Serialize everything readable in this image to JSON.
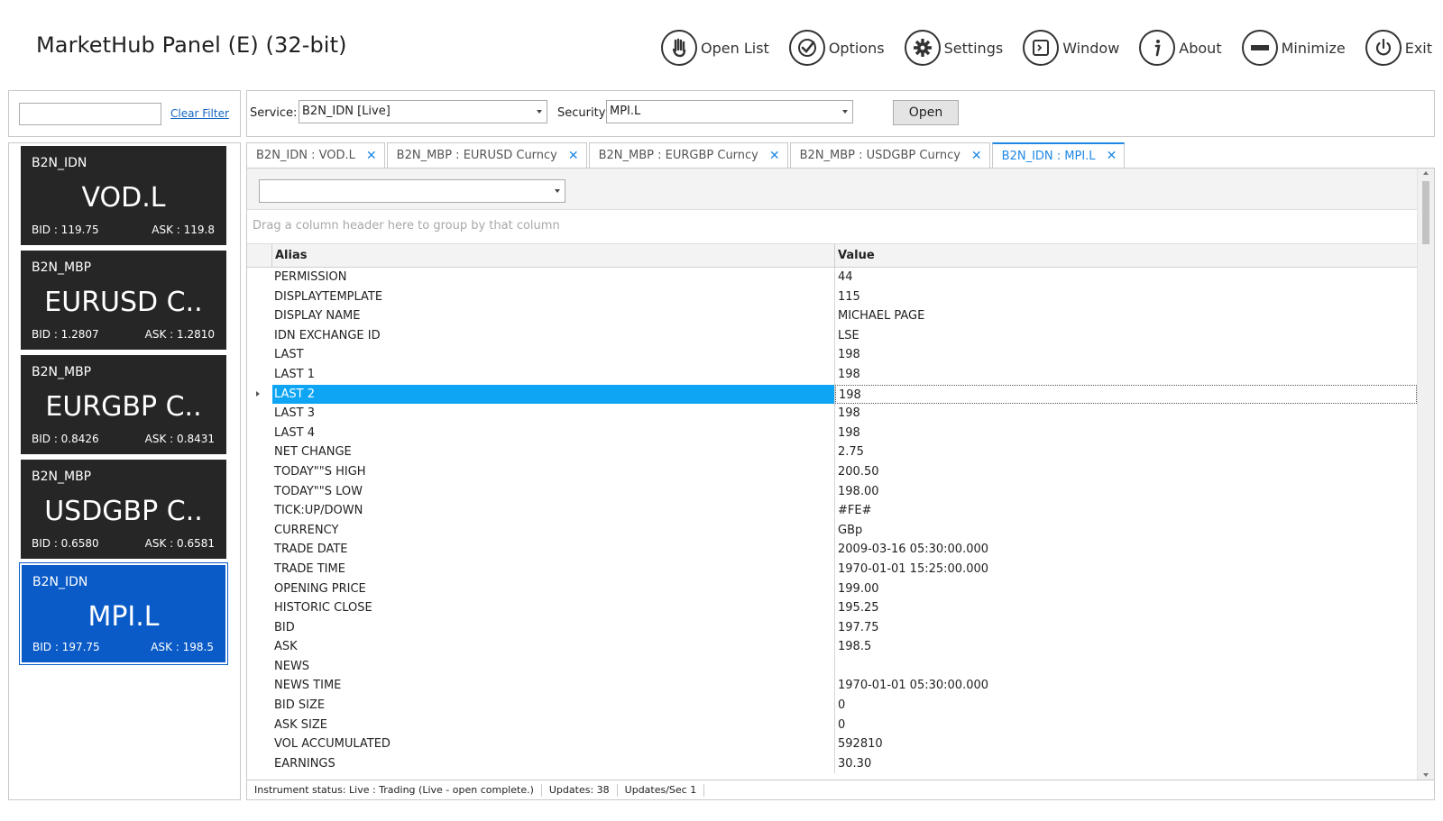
{
  "app": {
    "title": "MarketHub Panel (E) (32-bit)"
  },
  "toolbar": [
    {
      "label": "Open List",
      "icon": "open-list-icon"
    },
    {
      "label": "Options",
      "icon": "options-check-icon"
    },
    {
      "label": "Settings",
      "icon": "settings-gear-icon"
    },
    {
      "label": "Window",
      "icon": "window-icon"
    },
    {
      "label": "About",
      "icon": "info-icon"
    },
    {
      "label": "Minimize",
      "icon": "minimize-icon"
    },
    {
      "label": "Exit",
      "icon": "power-icon"
    }
  ],
  "filter": {
    "value": "",
    "clear_label": "Clear Filter"
  },
  "service_bar": {
    "service_label": "Service:",
    "service_value": "B2N_IDN [Live]",
    "security_label": "Security:",
    "security_value": "MPI.L",
    "open_label": "Open"
  },
  "tickers": [
    {
      "service": "B2N_IDN",
      "symbol": "VOD.L",
      "bid": "BID : 119.75",
      "ask": "ASK : 119.8",
      "active": false
    },
    {
      "service": "B2N_MBP",
      "symbol": "EURUSD C..",
      "bid": "BID : 1.2807",
      "ask": "ASK : 1.2810",
      "active": false
    },
    {
      "service": "B2N_MBP",
      "symbol": "EURGBP C..",
      "bid": "BID : 0.8426",
      "ask": "ASK : 0.8431",
      "active": false
    },
    {
      "service": "B2N_MBP",
      "symbol": "USDGBP C..",
      "bid": "BID : 0.6580",
      "ask": "ASK : 0.6581",
      "active": false
    },
    {
      "service": "B2N_IDN",
      "symbol": "MPI.L",
      "bid": "BID : 197.75",
      "ask": "ASK : 198.5",
      "active": true
    }
  ],
  "tabs": [
    {
      "label": "B2N_IDN : VOD.L",
      "active": false
    },
    {
      "label": "B2N_MBP : EURUSD Curncy",
      "active": false
    },
    {
      "label": "B2N_MBP : EURGBP Curncy",
      "active": false
    },
    {
      "label": "B2N_MBP : USDGBP Curncy",
      "active": false
    },
    {
      "label": "B2N_IDN : MPI.L",
      "active": true
    }
  ],
  "grid": {
    "group_hint": "Drag a column header here to group by that column",
    "col_alias": "Alias",
    "col_value": "Value",
    "selected_index": 6,
    "rows": [
      {
        "alias": "PERMISSION",
        "value": "44"
      },
      {
        "alias": "DISPLAYTEMPLATE",
        "value": "115"
      },
      {
        "alias": "DISPLAY NAME",
        "value": "MICHAEL PAGE"
      },
      {
        "alias": "IDN EXCHANGE ID",
        "value": "LSE"
      },
      {
        "alias": "LAST",
        "value": "198"
      },
      {
        "alias": "LAST 1",
        "value": "198"
      },
      {
        "alias": "LAST 2",
        "value": "198"
      },
      {
        "alias": "LAST 3",
        "value": "198"
      },
      {
        "alias": "LAST 4",
        "value": "198"
      },
      {
        "alias": "NET CHANGE",
        "value": "2.75"
      },
      {
        "alias": "TODAY\"\"S HIGH",
        "value": "200.50"
      },
      {
        "alias": "TODAY\"\"S LOW",
        "value": "198.00"
      },
      {
        "alias": "TICK:UP/DOWN",
        "value": "#FE#"
      },
      {
        "alias": "CURRENCY",
        "value": "GBp"
      },
      {
        "alias": "TRADE DATE",
        "value": "2009-03-16 05:30:00.000"
      },
      {
        "alias": "TRADE TIME",
        "value": "1970-01-01 15:25:00.000"
      },
      {
        "alias": "OPENING PRICE",
        "value": "199.00"
      },
      {
        "alias": "HISTORIC CLOSE",
        "value": "195.25"
      },
      {
        "alias": "BID",
        "value": "197.75"
      },
      {
        "alias": "ASK",
        "value": "198.5"
      },
      {
        "alias": "NEWS",
        "value": ""
      },
      {
        "alias": "NEWS TIME",
        "value": "1970-01-01 05:30:00.000"
      },
      {
        "alias": "BID SIZE",
        "value": "0"
      },
      {
        "alias": "ASK SIZE",
        "value": "0"
      },
      {
        "alias": "VOL ACCUMULATED",
        "value": "592810"
      },
      {
        "alias": "EARNINGS",
        "value": "30.30"
      }
    ]
  },
  "status": {
    "instrument": "Instrument status: Live : Trading (Live - open complete.)",
    "updates": "Updates: 38",
    "rate": "Updates/Sec 1"
  }
}
